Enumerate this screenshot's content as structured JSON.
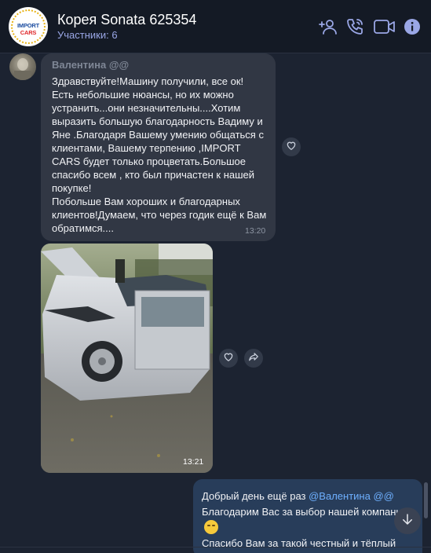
{
  "header": {
    "title": "Корея Sonata 625354",
    "subtitle": "Участники: 6",
    "avatar_logo": {
      "brand_part": "IMPORT",
      "cars_part": "CARS"
    }
  },
  "colors": {
    "accent": "#9aa7e6",
    "header_bg": "#141a25",
    "chat_bg": "#1c2331",
    "incoming_bubble": "#313744",
    "outgoing_bubble": "#283d5a",
    "mention": "#6eb0ff"
  },
  "icons": {
    "add_user": "add-user-icon",
    "call": "phone-icon",
    "video": "video-icon",
    "info": "info-icon",
    "like": "heart-icon",
    "forward": "forward-icon",
    "scroll": "arrow-down-icon"
  },
  "messages": {
    "incoming_text": {
      "sender": "Валентина @@",
      "text": "Здравствуйте!Машину получили, все ок!\nЕсть небольшие нюансы, но их можно устранить...они незначительны....Хотим выразить  большую благодарность Вадиму и Яне .Благодаря Вашему  умению общаться с клиентами, Вашему терпению ,IMPORT CARS будет только процветать.Большое спасибо  всем , кто был причастен к нашей покупке!\nПобольше Вам хороших и благодарных клиентов!Думаем, что через годик  ещё к Вам  обратимся....",
      "time": "13:20"
    },
    "incoming_photo": {
      "time": "13:21"
    },
    "outgoing_text": {
      "line1_prefix": "Добрый день ещё раз ",
      "mention": "@Валентина @@",
      "line2": "Благодарим  Вас за выбор нашей компании ",
      "line3": "Спасибо Вам за такой честный и тёплый"
    }
  }
}
